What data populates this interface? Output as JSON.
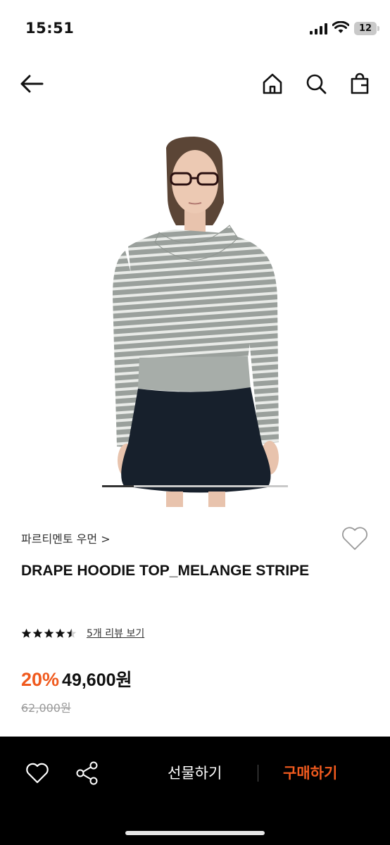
{
  "status_bar": {
    "time": "15:51",
    "battery": "12"
  },
  "nav": {
    "back_icon": "arrow-left-icon",
    "home_icon": "home-icon",
    "search_icon": "search-icon",
    "cart_icon": "shopping-bag-icon"
  },
  "gallery": {
    "progress": 0.17
  },
  "product": {
    "brand": "파르티멘토 우먼 >",
    "title": "DRAPE HOODIE TOP_MELANGE STRIPE",
    "rating": 4.5,
    "review_link": "5개 리뷰 보기",
    "discount": "20%",
    "price": "49,600원",
    "original_price": "62,000원"
  },
  "bottom_bar": {
    "gift_label": "선물하기",
    "buy_label": "구매하기"
  },
  "colors": {
    "accent": "#f05a1e",
    "bar_bg": "#000000"
  }
}
